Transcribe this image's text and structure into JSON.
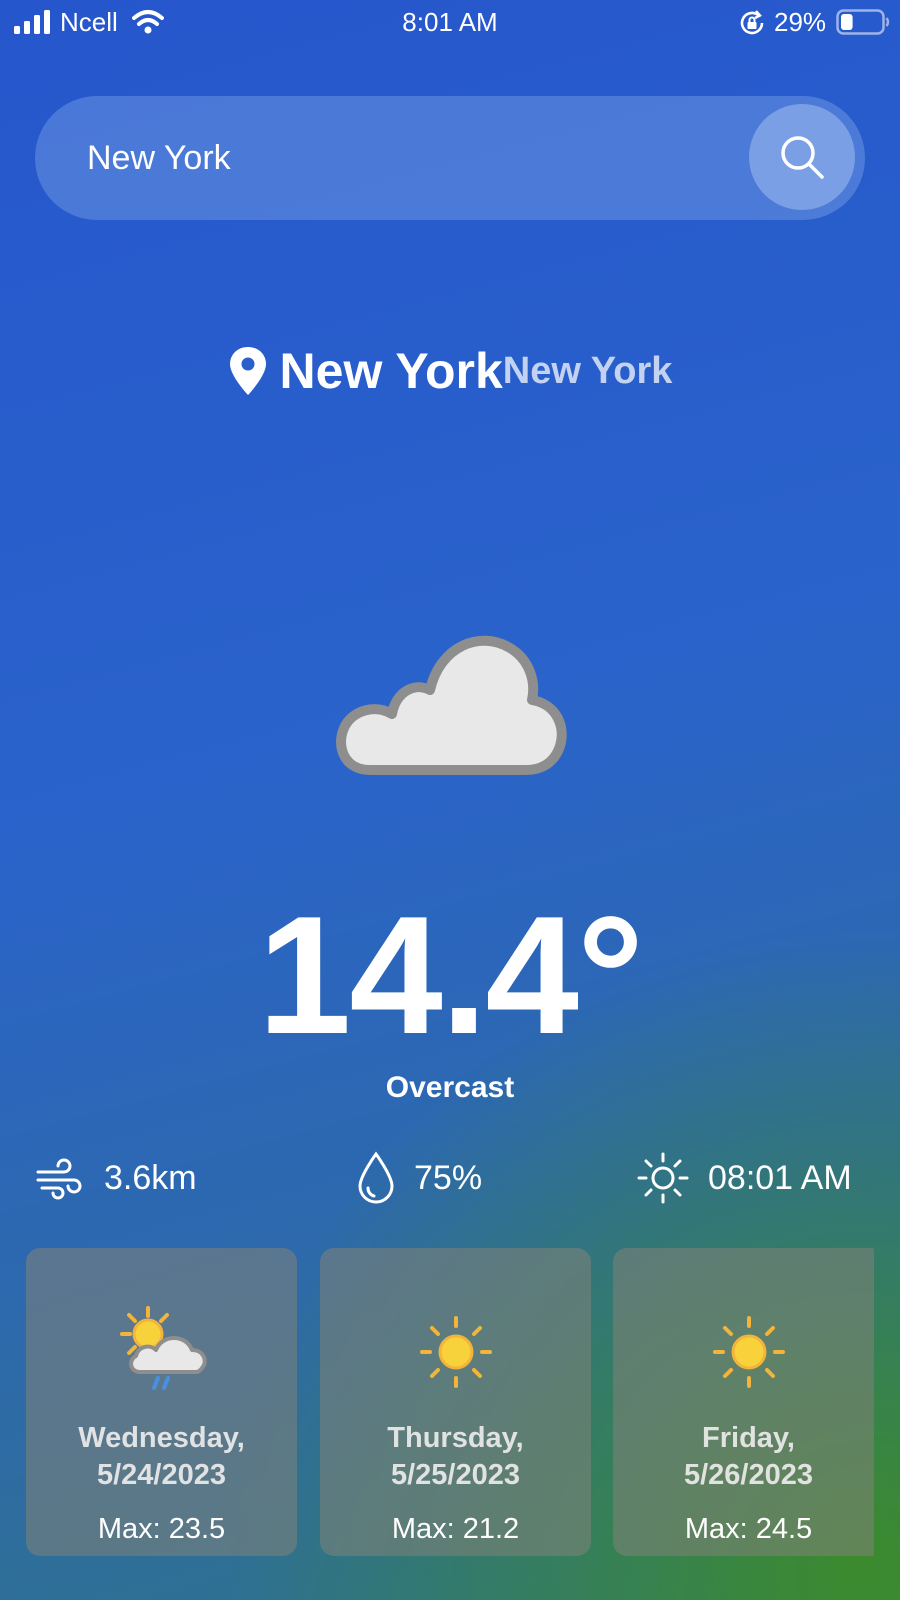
{
  "status_bar": {
    "carrier": "Ncell",
    "time": "8:01 AM",
    "battery_percent": "29%",
    "battery_level": 0.29,
    "icons": [
      "signal-icon",
      "wifi-icon",
      "rotation-lock-icon",
      "battery-icon"
    ]
  },
  "search": {
    "value": "New York",
    "icon": "search-icon"
  },
  "location": {
    "icon": "location-pin-icon",
    "city": "New York",
    "region": "New York"
  },
  "current": {
    "icon": "cloud-icon",
    "temperature": "14.4°",
    "condition": "Overcast",
    "wind": "3.6km",
    "humidity": "75%",
    "sunrise": "08:01 AM"
  },
  "forecast": [
    {
      "day": "Wednesday,",
      "date": "5/24/2023",
      "max": "Max: 23.5",
      "icon": "sun-cloud-rain-icon"
    },
    {
      "day": "Thursday,",
      "date": "5/25/2023",
      "max": "Max: 21.2",
      "icon": "sun-icon"
    },
    {
      "day": "Friday,",
      "date": "5/26/2023",
      "max": "Max: 24.5",
      "icon": "sun-icon"
    }
  ],
  "colors": {
    "background_top": "#2656cc",
    "background_bottom_corner": "#3c8c28",
    "text": "#ffffff",
    "sun": "#f7d23a",
    "cloud_fill": "#e8e8e8",
    "cloud_outline": "#8e8e8e"
  }
}
